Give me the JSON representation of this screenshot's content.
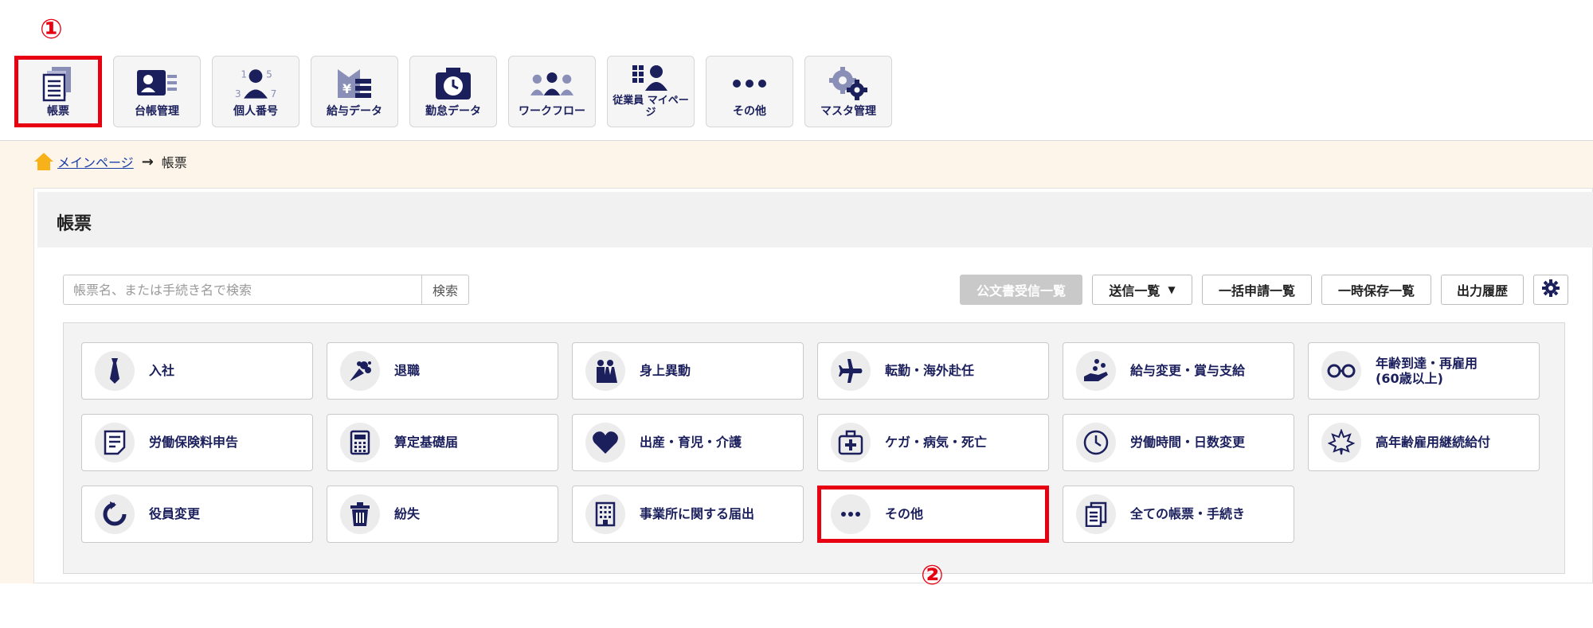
{
  "annotations": {
    "marker1": "①",
    "marker2": "②"
  },
  "modules": [
    {
      "label": "帳票",
      "icon": "documents-icon",
      "selected": true
    },
    {
      "label": "台帳管理",
      "icon": "id-card-icon"
    },
    {
      "label": "個人番号",
      "icon": "person-number-icon"
    },
    {
      "label": "給与データ",
      "icon": "payroll-icon"
    },
    {
      "label": "勤怠データ",
      "icon": "attendance-clock-icon"
    },
    {
      "label": "ワークフロー",
      "icon": "workflow-people-icon"
    },
    {
      "label": "従業員\nマイページ",
      "icon": "employee-mypage-icon"
    },
    {
      "label": "その他",
      "icon": "more-dots-icon"
    },
    {
      "label": "マスタ管理",
      "icon": "gears-icon"
    }
  ],
  "breadcrumb": {
    "home": "メインページ",
    "current": "帳票"
  },
  "page": {
    "title": "帳票"
  },
  "search": {
    "placeholder": "帳票名、または手続き名で検索",
    "button": "検索"
  },
  "toolbar": {
    "official_docs": "公文書受信一覧",
    "sent_list": "送信一覧",
    "bulk_list": "一括申請一覧",
    "saved_list": "一時保存一覧",
    "output_history": "出力履歴"
  },
  "tiles": [
    {
      "label": "入社",
      "icon": "necktie-icon"
    },
    {
      "label": "退職",
      "icon": "bouquet-icon"
    },
    {
      "label": "身上異動",
      "icon": "wedding-couple-icon"
    },
    {
      "label": "転勤・海外赴任",
      "icon": "airplane-icon"
    },
    {
      "label": "給与変更・賞与支給",
      "icon": "hand-coins-icon"
    },
    {
      "label": "年齢到達・再雇用\n(60歳以上)",
      "icon": "glasses-icon"
    },
    {
      "label": "労働保険料申告",
      "icon": "form-icon"
    },
    {
      "label": "算定基礎届",
      "icon": "calculator-icon"
    },
    {
      "label": "出産・育児・介護",
      "icon": "heart-icon"
    },
    {
      "label": "ケガ・病気・死亡",
      "icon": "first-aid-icon"
    },
    {
      "label": "労働時間・日数変更",
      "icon": "clock-icon"
    },
    {
      "label": "高年齢雇用継続給付",
      "icon": "maple-leaf-icon"
    },
    {
      "label": "役員変更",
      "icon": "refresh-icon"
    },
    {
      "label": "紛失",
      "icon": "trash-icon"
    },
    {
      "label": "事業所に関する届出",
      "icon": "building-icon"
    },
    {
      "label": "その他",
      "icon": "ellipsis-icon",
      "highlighted": true
    },
    {
      "label": "全ての帳票・手続き",
      "icon": "all-documents-icon"
    }
  ]
}
